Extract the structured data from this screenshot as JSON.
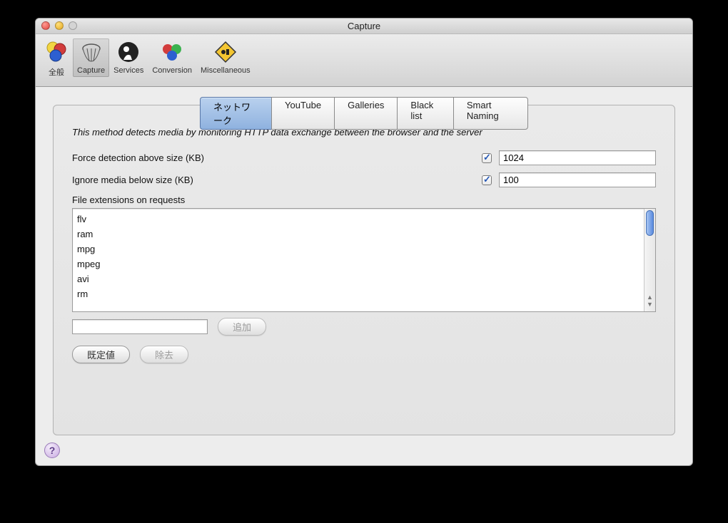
{
  "window": {
    "title": "Capture"
  },
  "toolbar": {
    "items": [
      {
        "label": "全般"
      },
      {
        "label": "Capture"
      },
      {
        "label": "Services"
      },
      {
        "label": "Conversion"
      },
      {
        "label": "Miscellaneous"
      }
    ],
    "selected_index": 1
  },
  "tabs": [
    "ネットワーク",
    "YouTube",
    "Galleries",
    "Black list",
    "Smart Naming"
  ],
  "active_tab_index": 0,
  "panel": {
    "description": "This method detects media by monitoring HTTP data exchange between the browser and the server",
    "force_label": "Force detection above size (KB)",
    "force_checked": true,
    "force_value": "1024",
    "ignore_label": "Ignore media below size (KB)",
    "ignore_checked": true,
    "ignore_value": "100",
    "ext_label": "File extensions on requests",
    "extensions": [
      "flv",
      "ram",
      "mpg",
      "mpeg",
      "avi",
      "rm"
    ],
    "add_input": "",
    "add_button": "追加",
    "defaults_button": "既定値",
    "remove_button": "除去"
  },
  "help_glyph": "?"
}
